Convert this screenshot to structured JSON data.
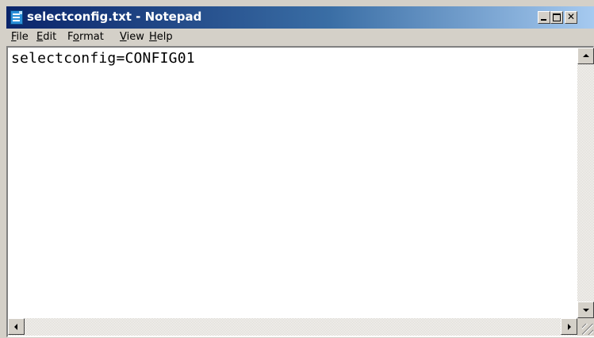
{
  "window": {
    "title": "selectconfig.txt - Notepad",
    "icon": "notepad-icon",
    "controls": {
      "minimize": "minimize-icon",
      "maximize": "maximize-icon",
      "close": "close-icon"
    }
  },
  "menu": {
    "items": [
      {
        "underline": "F",
        "rest": "ile"
      },
      {
        "underline": "E",
        "rest": "dit"
      },
      {
        "before": "F",
        "underline": "o",
        "rest": "rmat"
      },
      {
        "underline": "V",
        "rest": "iew"
      },
      {
        "underline": "H",
        "rest": "elp"
      }
    ]
  },
  "editor": {
    "content": "selectconfig=CONFIG01"
  },
  "colors": {
    "titlebar_start": "#0a246a",
    "titlebar_end": "#a6caf0",
    "chrome": "#d4d0c8",
    "editor_bg": "#ffffff"
  }
}
